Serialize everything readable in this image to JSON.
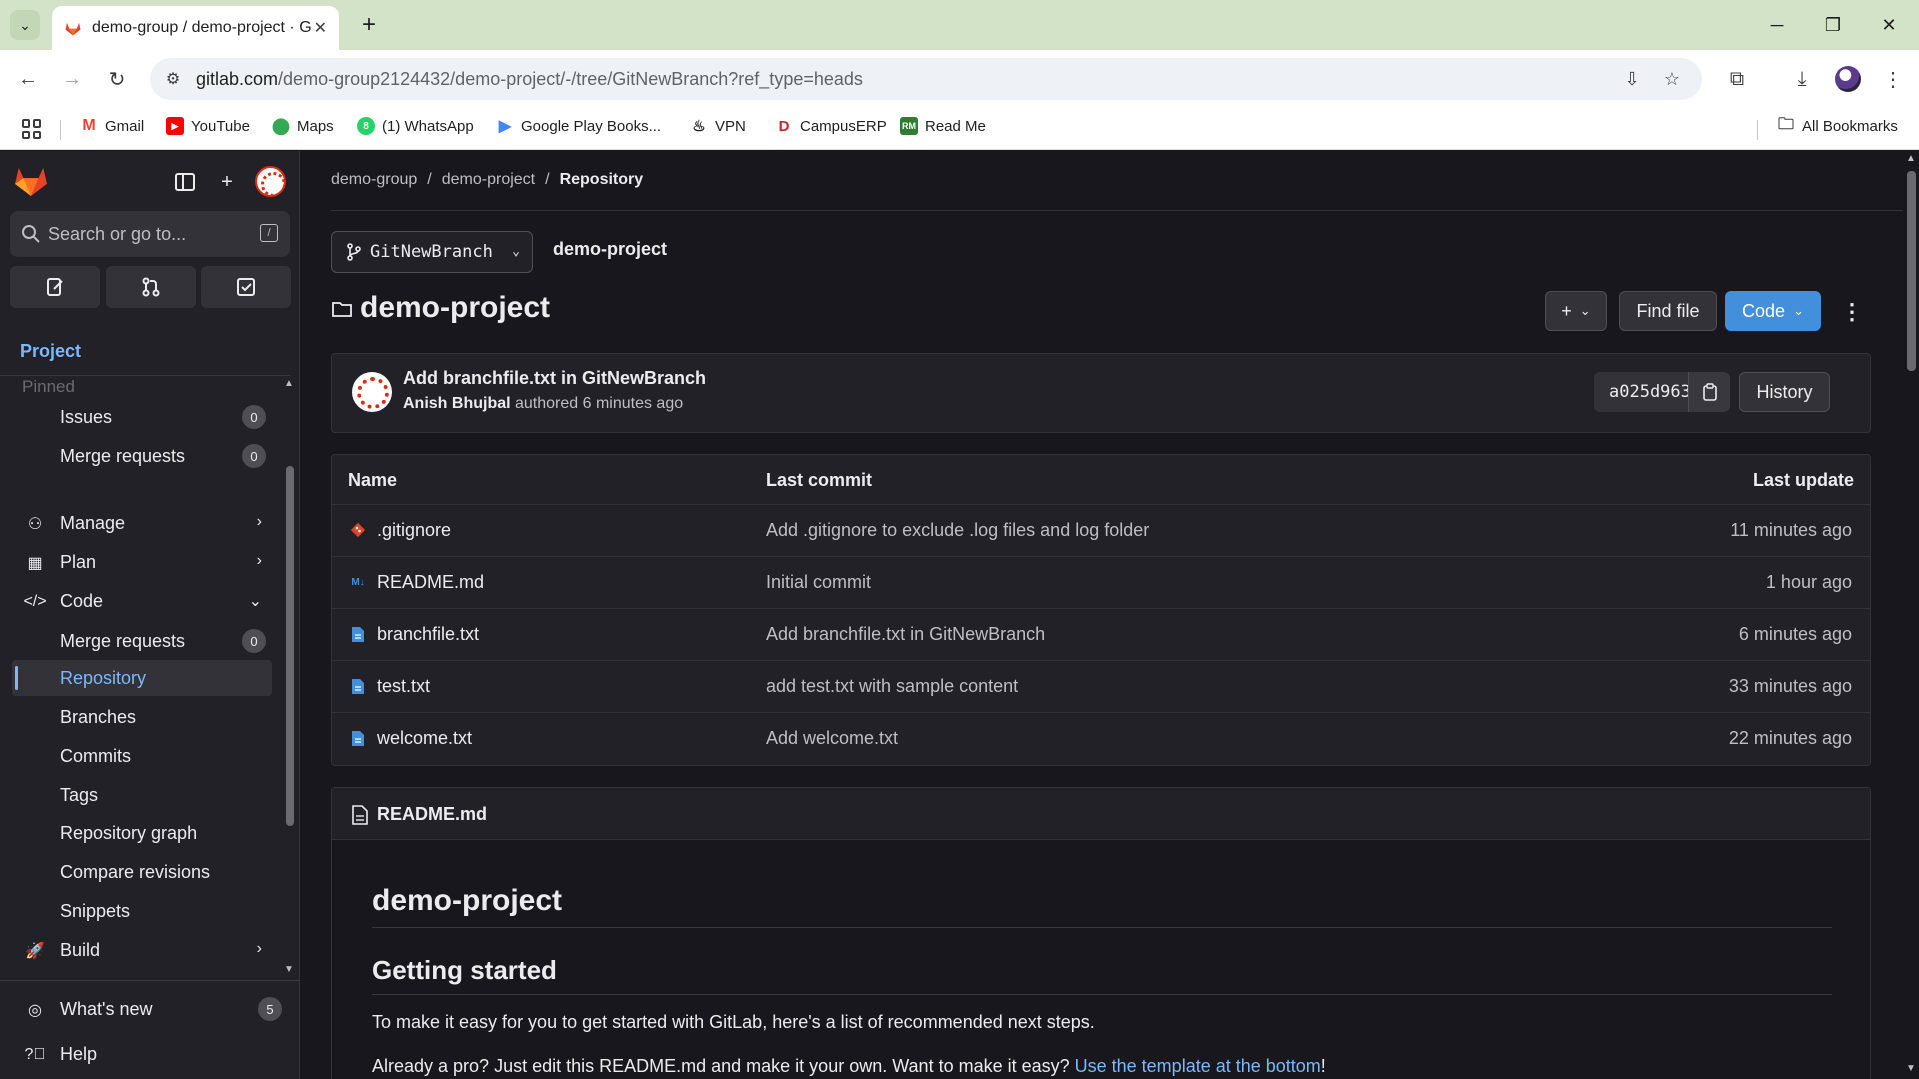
{
  "browser": {
    "tab_title": "demo-group / demo-project · G",
    "url_host": "gitlab.com",
    "url_path": "/demo-group2124432/demo-project/-/tree/GitNewBranch?ref_type=heads",
    "bookmarks": [
      {
        "label": "Gmail",
        "icon": "gmail-icon",
        "color": "#ea4335"
      },
      {
        "label": "YouTube",
        "icon": "youtube-icon",
        "color": "#ff0000"
      },
      {
        "label": "Maps",
        "icon": "maps-icon",
        "color": "#34a853"
      },
      {
        "label": "(1) WhatsApp",
        "icon": "whatsapp-icon",
        "color": "#25d366"
      },
      {
        "label": "Google Play Books...",
        "icon": "play-books-icon",
        "color": "#4285f4"
      },
      {
        "label": "VPN",
        "icon": "vpn-icon",
        "color": "#202124"
      },
      {
        "label": "CampusERP",
        "icon": "campuserp-icon",
        "color": "#c62828"
      },
      {
        "label": "Read Me",
        "icon": "readme-icon",
        "color": "#2e7d32"
      }
    ],
    "all_bookmarks": "All Bookmarks"
  },
  "sidebar": {
    "search_placeholder": "Search or go to...",
    "search_shortcut": "/",
    "project_heading": "Project",
    "pinned_label": "Pinned",
    "items": {
      "issues": {
        "label": "Issues",
        "count": "0"
      },
      "merge_requests_pinned": {
        "label": "Merge requests",
        "count": "0"
      },
      "manage": {
        "label": "Manage"
      },
      "plan": {
        "label": "Plan"
      },
      "code": {
        "label": "Code"
      },
      "merge_requests": {
        "label": "Merge requests",
        "count": "0"
      },
      "repository": {
        "label": "Repository"
      },
      "branches": {
        "label": "Branches"
      },
      "commits": {
        "label": "Commits"
      },
      "tags": {
        "label": "Tags"
      },
      "repository_graph": {
        "label": "Repository graph"
      },
      "compare_revisions": {
        "label": "Compare revisions"
      },
      "snippets": {
        "label": "Snippets"
      },
      "build": {
        "label": "Build"
      }
    },
    "whats_new": {
      "label": "What's new",
      "count": "5"
    },
    "help": {
      "label": "Help"
    }
  },
  "main": {
    "breadcrumb": [
      "demo-group",
      "demo-project",
      "Repository"
    ],
    "branch_name": "GitNewBranch",
    "project_link": "demo-project",
    "title": "demo-project",
    "buttons": {
      "add": "+",
      "find_file": "Find file",
      "code": "Code",
      "history": "History"
    },
    "last_commit": {
      "title": "Add branchfile.txt in GitNewBranch",
      "author": "Anish Bhujbal",
      "meta": " authored 6 minutes ago",
      "sha": "a025d963"
    },
    "table": {
      "headers": {
        "name": "Name",
        "last_commit": "Last commit",
        "last_update": "Last update"
      },
      "rows": [
        {
          "name": ".gitignore",
          "icon": "git-file-icon",
          "commit": "Add .gitignore to exclude .log files and log folder",
          "updated": "11 minutes ago"
        },
        {
          "name": "README.md",
          "icon": "markdown-file-icon",
          "commit": "Initial commit",
          "updated": "1 hour ago"
        },
        {
          "name": "branchfile.txt",
          "icon": "text-file-icon",
          "commit": "Add branchfile.txt in GitNewBranch",
          "updated": "6 minutes ago"
        },
        {
          "name": "test.txt",
          "icon": "text-file-icon",
          "commit": "add test.txt with sample content",
          "updated": "33 minutes ago"
        },
        {
          "name": "welcome.txt",
          "icon": "text-file-icon",
          "commit": "Add welcome.txt",
          "updated": "22 minutes ago"
        }
      ]
    },
    "readme": {
      "filename": "README.md",
      "h1": "demo-project",
      "h2": "Getting started",
      "p1": "To make it easy for you to get started with GitLab, here's a list of recommended next steps.",
      "p2_text": "Already a pro? Just edit this README.md and make it your own. Want to make it easy? ",
      "p2_link": "Use the template at the bottom",
      "p2_end": "!"
    }
  },
  "colors": {
    "accent": "#7ab8ff",
    "primary_button": "#428fdc",
    "sidebar_bg": "#232128",
    "page_bg": "#18171d",
    "tabbar_bg": "#d3e3c8"
  }
}
